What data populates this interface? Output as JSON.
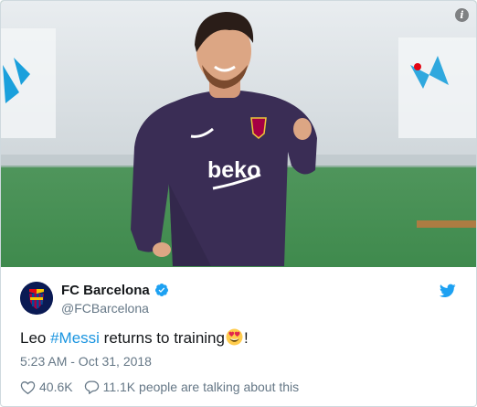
{
  "media": {
    "info_glyph": "i"
  },
  "account": {
    "name": "FC Barcelona",
    "handle": "@FCBarcelona",
    "verified": true
  },
  "tweet": {
    "text_before": "Leo ",
    "hashtag": "#Messi",
    "text_after": " returns to training",
    "text_end": "!",
    "timestamp": "5:23 AM - Oct 31, 2018"
  },
  "actions": {
    "likes": "40.6K",
    "talking": "11.1K people are talking about this"
  },
  "colors": {
    "link": "#1b95e0",
    "muted": "#657786",
    "text": "#14171a"
  }
}
